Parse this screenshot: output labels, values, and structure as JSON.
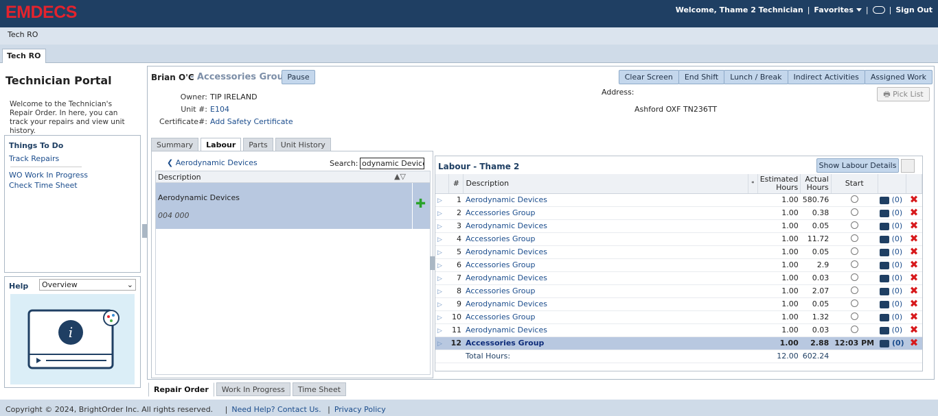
{
  "app": {
    "logo": "EMDECS",
    "welcome": "Welcome, Thame 2 Technician",
    "favorites": "Favorites",
    "sign_out": "Sign Out",
    "crumb": "Tech RO",
    "main_tab": "Tech RO"
  },
  "left": {
    "title": "Technician Portal",
    "desc": "Welcome to the Technician's Repair Order. In here, you can track your repairs and view unit history.",
    "todo_title": "Things To Do",
    "todo": [
      "Track Repairs",
      "WO Work In Progress",
      "Check Time Sheet"
    ],
    "help_label": "Help",
    "help_select": "Overview"
  },
  "header": {
    "tech": "Brian O'C",
    "group": "- Accessories Group",
    "pause": "Pause",
    "owner_label": "Owner:",
    "owner": "TIP IRELAND",
    "unit_label": "Unit #:",
    "unit": "E104",
    "cert_label": "Certificate#:",
    "cert": "Add Safety Certificate",
    "address_label": "Address:",
    "address": "Ashford OXF TN236TT",
    "pick_list": "Pick List",
    "buttons": [
      "Clear Screen",
      "End Shift",
      "Lunch / Break",
      "Indirect Activities",
      "Assigned Work"
    ]
  },
  "subtabs": [
    "Summary",
    "Labour",
    "Parts",
    "Unit History"
  ],
  "search": {
    "crumb": "Aerodynamic Devices",
    "label": "Search:",
    "value": "odynamic Devices"
  },
  "desc_table": {
    "header": "Description",
    "row_title": "Aerodynamic Devices",
    "row_code": "004 000"
  },
  "labour": {
    "title": "Labour - Thame 2",
    "show_details": "Show Labour Details",
    "cols": [
      "#",
      "Description",
      "*",
      "Estimated Hours",
      "Actual Hours",
      "Start"
    ],
    "rows": [
      {
        "n": "1",
        "d": "Aerodynamic Devices",
        "e": "1.00",
        "a": "580.76",
        "s": "",
        "c": "(0)"
      },
      {
        "n": "2",
        "d": "Accessories Group",
        "e": "1.00",
        "a": "0.38",
        "s": "",
        "c": "(0)"
      },
      {
        "n": "3",
        "d": "Aerodynamic Devices",
        "e": "1.00",
        "a": "0.05",
        "s": "",
        "c": "(0)"
      },
      {
        "n": "4",
        "d": "Accessories Group",
        "e": "1.00",
        "a": "11.72",
        "s": "",
        "c": "(0)"
      },
      {
        "n": "5",
        "d": "Aerodynamic Devices",
        "e": "1.00",
        "a": "0.05",
        "s": "",
        "c": "(0)"
      },
      {
        "n": "6",
        "d": "Accessories Group",
        "e": "1.00",
        "a": "2.9",
        "s": "",
        "c": "(0)"
      },
      {
        "n": "7",
        "d": "Aerodynamic Devices",
        "e": "1.00",
        "a": "0.03",
        "s": "",
        "c": "(0)"
      },
      {
        "n": "8",
        "d": "Accessories Group",
        "e": "1.00",
        "a": "2.07",
        "s": "",
        "c": "(0)"
      },
      {
        "n": "9",
        "d": "Aerodynamic Devices",
        "e": "1.00",
        "a": "0.05",
        "s": "",
        "c": "(0)"
      },
      {
        "n": "10",
        "d": "Accessories Group",
        "e": "1.00",
        "a": "1.32",
        "s": "",
        "c": "(0)"
      },
      {
        "n": "11",
        "d": "Aerodynamic Devices",
        "e": "1.00",
        "a": "0.03",
        "s": "",
        "c": "(0)"
      },
      {
        "n": "12",
        "d": "Accessories Group",
        "e": "1.00",
        "a": "2.88",
        "s": "12:03 PM",
        "c": "(0)",
        "sel": true
      }
    ],
    "total_label": "Total Hours:",
    "total_est": "12.00",
    "total_act": "602.24"
  },
  "bottom_tabs": [
    "Repair Order",
    "Work In Progress",
    "Time Sheet"
  ],
  "footer": {
    "copy": "Copyright © 2024, BrightOrder Inc. All rights reserved.",
    "help": "Need Help? Contact Us.",
    "privacy": "Privacy Policy"
  }
}
